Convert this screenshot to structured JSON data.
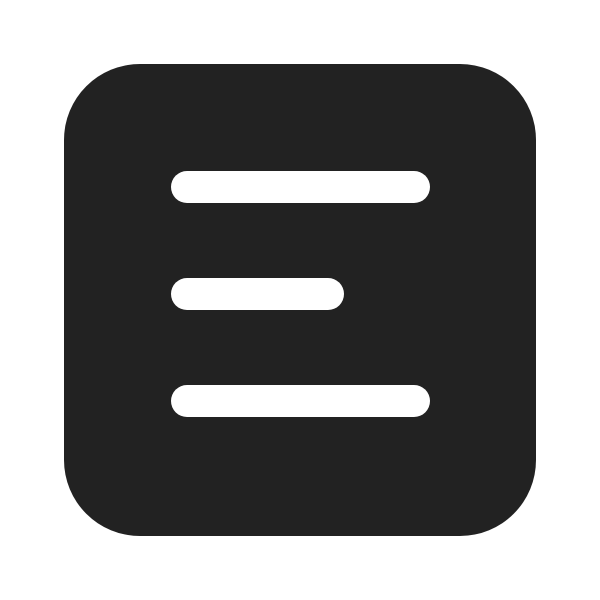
{
  "icon": {
    "name": "text-align-left-square-icon",
    "colors": {
      "background": "#ffffff",
      "tile": "#222222",
      "lines": "#ffffff"
    }
  }
}
